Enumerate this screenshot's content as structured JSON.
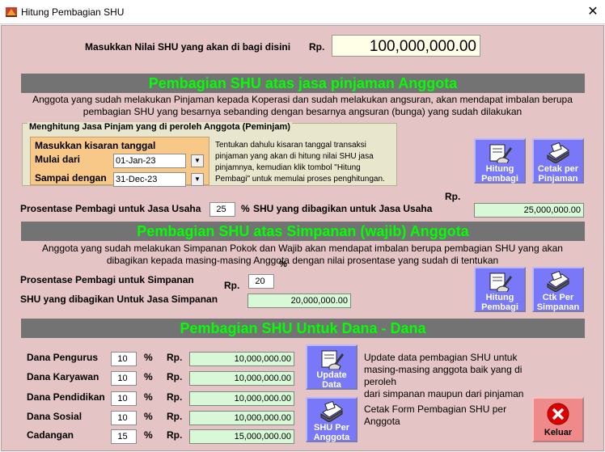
{
  "window": {
    "title": "Hitung Pembagian SHU",
    "close_glyph": "✕"
  },
  "header": {
    "label": "Masukkan Nilai SHU yang akan di bagi disini",
    "currency": "Rp.",
    "value": "100,000,000.00"
  },
  "pinjaman": {
    "banner": "Pembagian SHU atas jasa pinjaman Anggota",
    "desc_line1": "Anggota yang sudah melakukan Pinjaman kepada Koperasi dan sudah melakukan angsuran, akan mendapat imbalan berupa",
    "desc_line2": "pembagian SHU yang besarnya sebanding dengan besarnya angsuran (bunga) yang sudah dilakukan",
    "group_title": "Menghitung Jasa Pinjam yang di peroleh Anggota (Peminjam)",
    "range_title": "Masukkan kisaran tanggal",
    "from_label": "Mulai dari",
    "from_value": "01-Jan-23",
    "to_label": "Sampai dengan",
    "to_value": "31-Dec-23",
    "hint_lines": [
      "Tentukan dahulu kisaran tanggal transaksi",
      "pinjaman yang akan di hitung nilai SHU jasa",
      "pinjamnya, kemudian klik tombol \"Hitung",
      "Pembagi\" untuk memulai proses penghitungan."
    ],
    "btn_hitung": [
      "Hitung",
      "Pembagi"
    ],
    "btn_cetak": [
      "Cetak per",
      "Pinjaman"
    ],
    "pct_label": "Prosentase Pembagi untuk Jasa Usaha",
    "pct_value": "25",
    "pct_sign": "%",
    "shu_label": "SHU yang dibagikan untuk Jasa Usaha",
    "currency": "Rp.",
    "shu_value": "25,000,000.00"
  },
  "simpanan": {
    "banner": "Pembagian SHU atas Simpanan (wajib) Anggota",
    "desc_line1": "Anggota yang sudah melakukan Simpanan Pokok dan Wajib akan mendapat  imbalan berupa pembagian SHU yang akan",
    "desc_line2": "dibagikan kepada masing-masing Anggota dengan nilai prosentase yang sudah di tentukan",
    "pct_sign": "%",
    "pct_label": "Prosentase Pembagi untuk Simpanan",
    "currency": "Rp.",
    "pct_value": "20",
    "shu_label": "SHU yang dibagikan Untuk Jasa Simpanan",
    "shu_value": "20,000,000.00",
    "btn_hitung": [
      "Hitung",
      "Pembagi"
    ],
    "btn_ctk": [
      "Ctk Per",
      "Simpanan"
    ]
  },
  "dana": {
    "banner": "Pembagian SHU Untuk Dana - Dana",
    "pct_sign": "%",
    "currency": "Rp.",
    "rows": [
      {
        "label": "Dana Pengurus",
        "pct": "10",
        "value": "10,000,000.00"
      },
      {
        "label": "Dana Karyawan",
        "pct": "10",
        "value": "10,000,000.00"
      },
      {
        "label": "Dana Pendidikan",
        "pct": "10",
        "value": "10,000,000.00"
      },
      {
        "label": "Dana Sosial",
        "pct": "10",
        "value": "10,000,000.00"
      },
      {
        "label": "Cadangan",
        "pct": "15",
        "value": "15,000,000.00"
      }
    ],
    "btn_update": [
      "Update",
      "Data"
    ],
    "update_desc": [
      "Update data pembagian SHU untuk",
      "masing-masing anggota baik yang di peroleh",
      "dari simpanan maupun dari pinjaman"
    ],
    "btn_shu": [
      "SHU Per",
      "Anggota"
    ],
    "shu_desc": [
      "Cetak Form Pembagian SHU per",
      "Anggota"
    ],
    "btn_keluar": "Keluar"
  },
  "colors": {
    "banner_bg": "#737373",
    "banner_text": "#00ff00",
    "body_bg": "#e4c4c4",
    "button_blue": "#7878f8",
    "field_green": "#d8f8d8"
  },
  "icons": [
    "app-icon",
    "close-icon",
    "hand-pen-icon",
    "printer-icon",
    "close-circle-icon",
    "chevron-down-icon"
  ]
}
